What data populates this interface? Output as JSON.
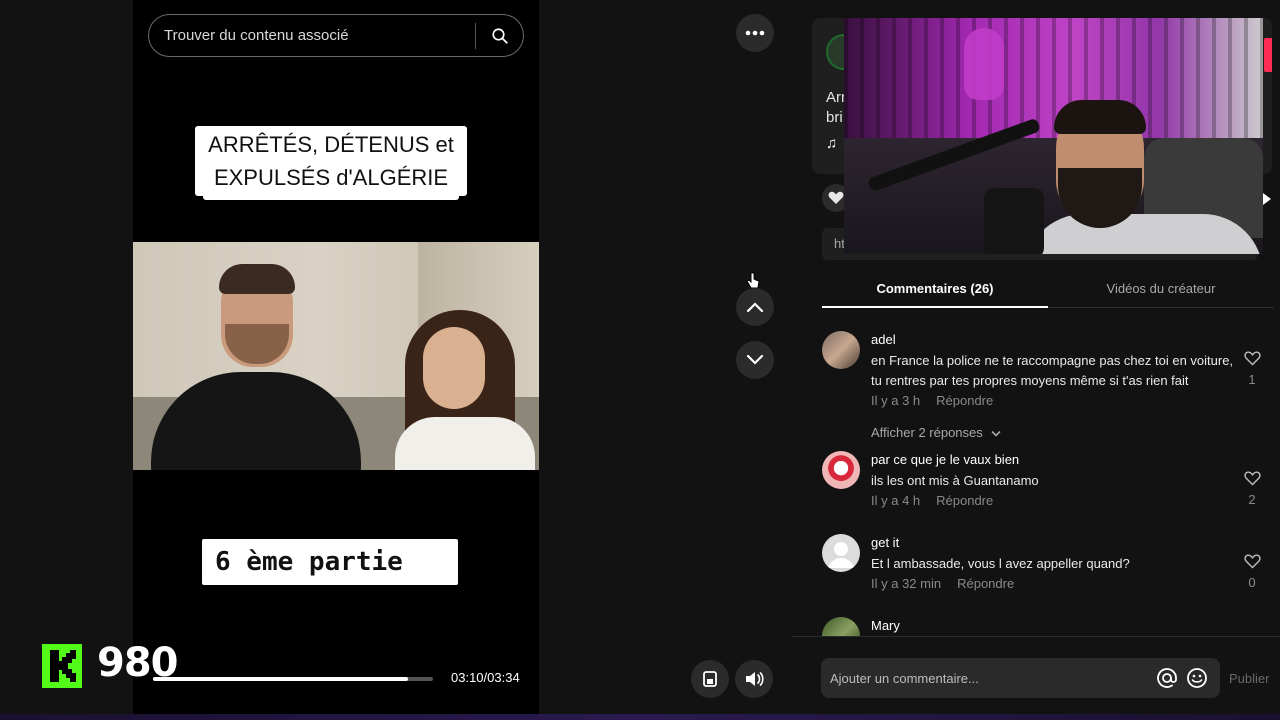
{
  "search": {
    "placeholder": "Trouver du contenu associé"
  },
  "video": {
    "title_line1": "ARRÊTÉS, DÉTENUS et",
    "title_line2": "EXPULSÉS d'ALGÉRIE",
    "part_label": "6 ème partie",
    "time": "03:10/03:34",
    "progress": 0.91
  },
  "overlay": {
    "viewer_count": "980"
  },
  "post": {
    "desc_line1": "Arr",
    "desc_line2": "bri",
    "music_icon": "♫",
    "link_prefix": "ht"
  },
  "tabs": [
    {
      "label": "Commentaires (26)"
    },
    {
      "label": "Vidéos du créateur"
    }
  ],
  "comments": [
    {
      "user": "adel",
      "text": "en France la police ne te raccompagne pas chez toi en voiture, tu rentres par tes propres moyens même si t'as rien fait",
      "time": "Il y a 3 h",
      "reply": "Répondre",
      "likes": "1",
      "more": "Afficher 2 réponses"
    },
    {
      "user": "par ce que je le vaux bien",
      "text": "ils les ont mis à Guantanamo",
      "time": "Il y a 4 h",
      "reply": "Répondre",
      "likes": "2"
    },
    {
      "user": "get it",
      "text": "Et l ambassade, vous l avez appeller quand?",
      "time": "Il y a 32 min",
      "reply": "Répondre",
      "likes": "0"
    },
    {
      "user": "Mary"
    }
  ],
  "comment_input": {
    "placeholder": "Ajouter un commentaire...",
    "publish": "Publier"
  }
}
